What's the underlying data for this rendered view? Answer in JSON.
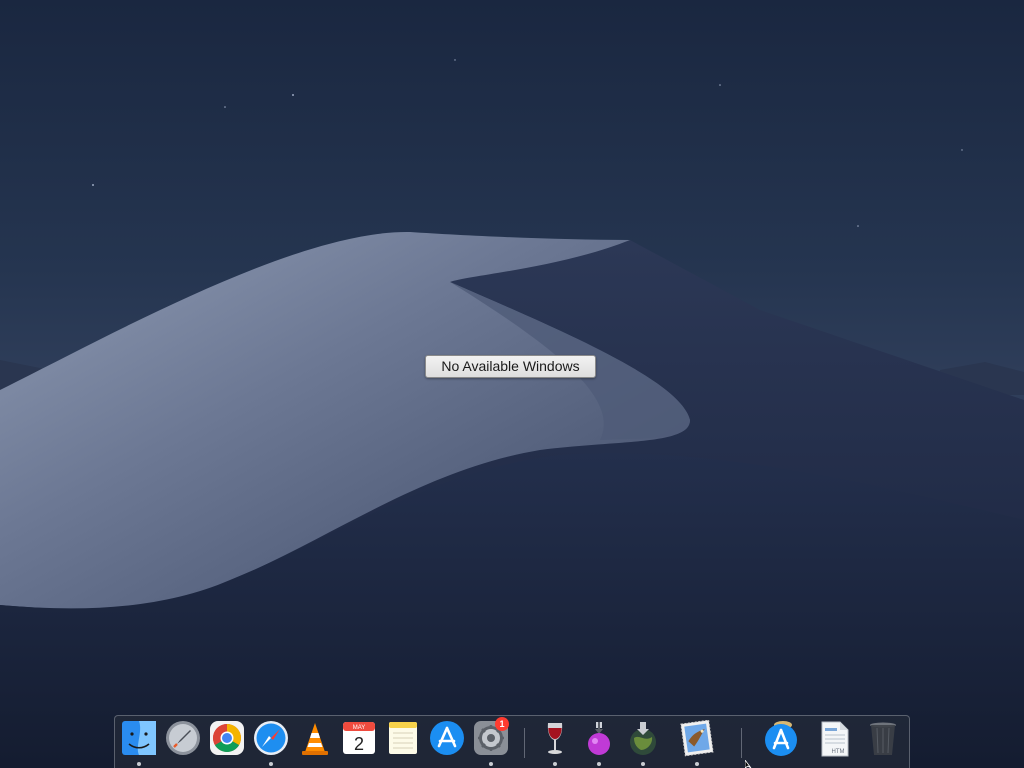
{
  "desktop": {
    "message": "No Available Windows"
  },
  "dock": {
    "items": [
      {
        "name": "finder",
        "icon": "finder-icon",
        "running": true
      },
      {
        "name": "launchpad",
        "icon": "rocket-icon",
        "running": false
      },
      {
        "name": "chrome",
        "icon": "chrome-icon",
        "running": false
      },
      {
        "name": "safari",
        "icon": "compass-icon",
        "running": true
      },
      {
        "name": "vlc",
        "icon": "traffic-cone-icon",
        "running": false
      },
      {
        "name": "calendar",
        "icon": "calendar-icon",
        "running": false,
        "month": "MAY",
        "day": "2"
      },
      {
        "name": "notes",
        "icon": "notes-icon",
        "running": false
      },
      {
        "name": "app-store",
        "icon": "app-store-icon",
        "running": false
      },
      {
        "name": "system-preferences",
        "icon": "gear-icon",
        "running": true,
        "badge": "1"
      },
      {
        "name": "wine",
        "icon": "wine-glass-icon",
        "running": true
      },
      {
        "name": "installer",
        "icon": "potion-flask-icon",
        "running": true
      },
      {
        "name": "download-globe",
        "icon": "globe-download-icon",
        "running": true
      },
      {
        "name": "preview",
        "icon": "eagle-stamp-icon",
        "running": true
      },
      {
        "name": "app-store-downloads",
        "icon": "app-store-icon",
        "running": false
      },
      {
        "name": "document",
        "icon": "document-icon",
        "running": false,
        "label": "HTM"
      },
      {
        "name": "trash",
        "icon": "trash-icon",
        "running": false
      }
    ]
  },
  "colors": {
    "dock_bg": "#282e3a",
    "badge": "#ff3b30",
    "sky_top": "#1d2a40"
  }
}
